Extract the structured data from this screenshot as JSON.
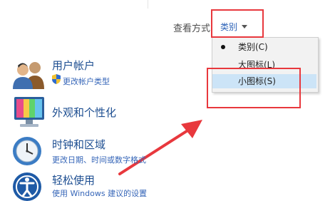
{
  "viewby": {
    "label": "查看方式",
    "value": "类别"
  },
  "menu": {
    "items": [
      {
        "label": "类别(C)",
        "selected": true
      },
      {
        "label": "大图标(L)",
        "selected": false
      },
      {
        "label": "小图标(S)",
        "selected": false,
        "highlighted": true
      }
    ]
  },
  "categories": [
    {
      "title": "用户帐户",
      "link": "更改帐户类型",
      "icon": "users-icon",
      "link_icon": "shield-icon"
    },
    {
      "title": "外观和个性化",
      "icon": "monitor-icon"
    },
    {
      "title": "时钟和区域",
      "link": "更改日期、时间或数字格式",
      "icon": "clock-globe-icon"
    },
    {
      "title": "轻松使用",
      "link": "使用 Windows 建议的设置",
      "icon": "ease-of-access-icon"
    }
  ],
  "colors": {
    "link": "#3666b8",
    "title": "#1d4e91",
    "highlight": "#cce4f7",
    "annotation": "#e8383d"
  }
}
